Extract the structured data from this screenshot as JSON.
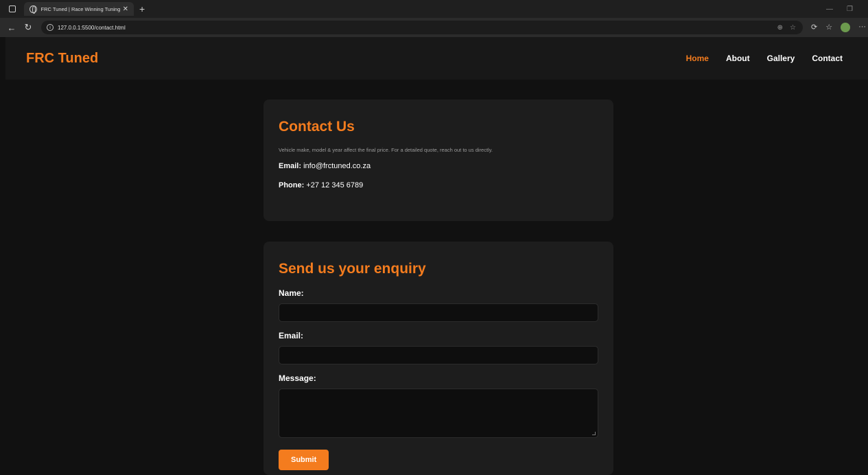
{
  "browser": {
    "tab_title": "FRC Tuned | Race Winning Tuning",
    "url": "127.0.0.1:5500/contact.html"
  },
  "site": {
    "brand": "FRC Tuned",
    "nav": [
      {
        "label": "Home",
        "active": true
      },
      {
        "label": "About",
        "active": false
      },
      {
        "label": "Gallery",
        "active": false
      },
      {
        "label": "Contact",
        "active": false
      }
    ]
  },
  "contact": {
    "title": "Contact Us",
    "note": "Vehicle make, model & year affect the final price. For a detailed quote, reach out to us directly.",
    "email_label": "Email:",
    "email_value": "info@frctuned.co.za",
    "phone_label": "Phone:",
    "phone_value": "+27 12 345 6789"
  },
  "enquiry": {
    "title": "Send us your enquiry",
    "name_label": "Name:",
    "name_value": "",
    "email_label": "Email:",
    "email_value": "",
    "message_label": "Message:",
    "message_value": "",
    "submit_label": "Submit"
  },
  "colors": {
    "accent": "#f47c1e",
    "background": "#111111",
    "card": "#1d1d1d"
  }
}
